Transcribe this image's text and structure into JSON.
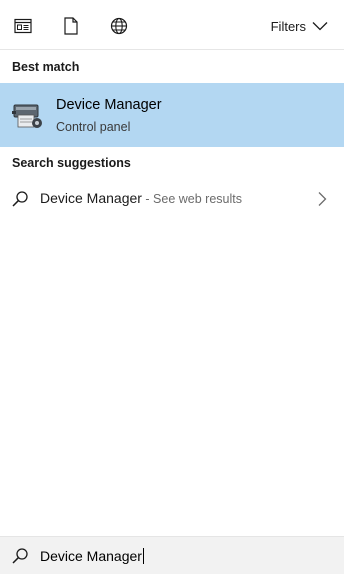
{
  "toolbar": {
    "icons": [
      "apps-icon",
      "documents-icon",
      "web-globe-icon"
    ],
    "filters_label": "Filters"
  },
  "sections": {
    "best_match_header": "Best match",
    "suggestions_header": "Search suggestions"
  },
  "best_match": {
    "title": "Device Manager",
    "subtitle": "Control panel",
    "icon": "device-manager-icon",
    "highlight_color": "#b3d7f2"
  },
  "suggestion": {
    "query": "Device Manager",
    "suffix": " - See web results",
    "icon": "search-icon",
    "chevron": "chevron-right-icon"
  },
  "searchbox": {
    "value": "Device Manager",
    "icon": "search-icon",
    "background": "#f2f2f2"
  }
}
